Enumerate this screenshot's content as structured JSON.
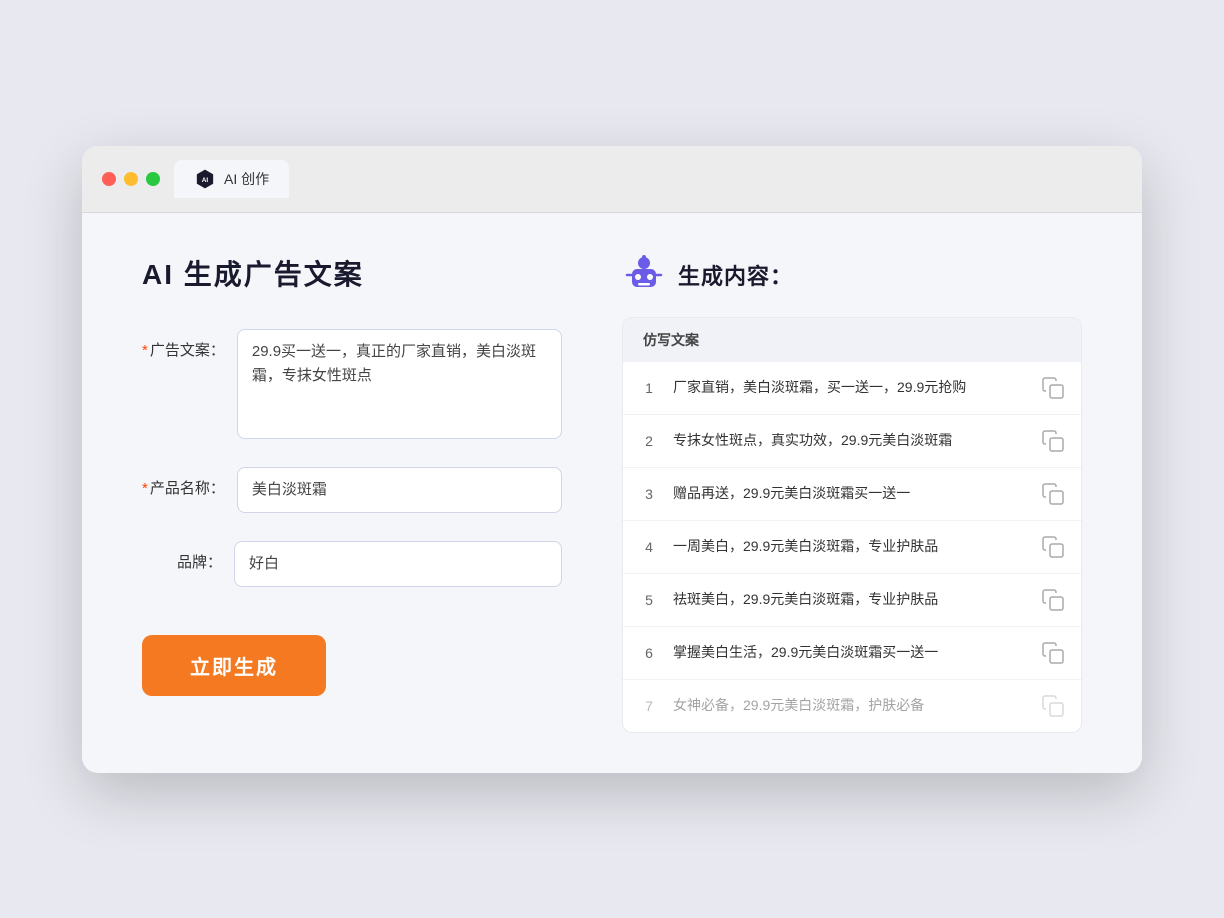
{
  "browser": {
    "tab_label": "AI 创作"
  },
  "page": {
    "title": "AI 生成广告文案"
  },
  "form": {
    "ad_copy_label": "广告文案：",
    "ad_copy_required": "*",
    "ad_copy_value": "29.9买一送一，真正的厂家直销，美白淡斑霜，专抹女性斑点",
    "product_name_label": "产品名称：",
    "product_name_required": "*",
    "product_name_value": "美白淡斑霜",
    "brand_label": "品牌：",
    "brand_value": "好白",
    "generate_button": "立即生成"
  },
  "result": {
    "title": "生成内容：",
    "column_header": "仿写文案",
    "items": [
      {
        "num": "1",
        "text": "厂家直销，美白淡斑霜，买一送一，29.9元抢购"
      },
      {
        "num": "2",
        "text": "专抹女性斑点，真实功效，29.9元美白淡斑霜"
      },
      {
        "num": "3",
        "text": "赠品再送，29.9元美白淡斑霜买一送一"
      },
      {
        "num": "4",
        "text": "一周美白，29.9元美白淡斑霜，专业护肤品"
      },
      {
        "num": "5",
        "text": "祛斑美白，29.9元美白淡斑霜，专业护肤品"
      },
      {
        "num": "6",
        "text": "掌握美白生活，29.9元美白淡斑霜买一送一"
      },
      {
        "num": "7",
        "text": "女神必备，29.9元美白淡斑霜，护肤必备"
      }
    ]
  }
}
